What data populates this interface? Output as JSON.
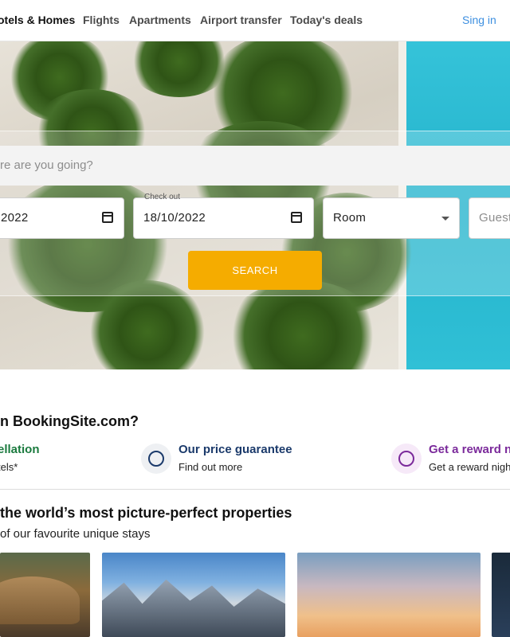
{
  "nav": {
    "items": [
      {
        "label": "otels & Homes",
        "active": true
      },
      {
        "label": "Flights",
        "active": false
      },
      {
        "label": "Apartments",
        "active": false
      },
      {
        "label": "Airport transfer",
        "active": false
      },
      {
        "label": "Today's deals",
        "active": false
      }
    ],
    "signin_label": "Sing in"
  },
  "search": {
    "destination_placeholder": "re are you going?",
    "checkin_value": "2022",
    "checkout_label": "Check out",
    "checkout_value": "18/10/2022",
    "room_value": "Room",
    "guests_placeholder": "Guest",
    "search_label": "SEARCH"
  },
  "why": {
    "title": "n BookingSite.com?",
    "benefits": [
      {
        "title": "ellation",
        "subtitle": "tels*",
        "color": "#1a7a3e",
        "icon": "none"
      },
      {
        "title": "Our price guarantee",
        "subtitle": "Find out more",
        "color": "#1b3a6b",
        "icon": "info-icon"
      },
      {
        "title": "Get a reward n",
        "subtitle": "Get a reward nigh",
        "color": "#7b2a9b",
        "icon": "info-icon"
      }
    ]
  },
  "properties": {
    "title": " the world’s most picture-perfect properties",
    "subtitle": "of our favourite unique stays"
  },
  "colors": {
    "accent": "#f5ac00",
    "link": "#3d8fe0"
  }
}
